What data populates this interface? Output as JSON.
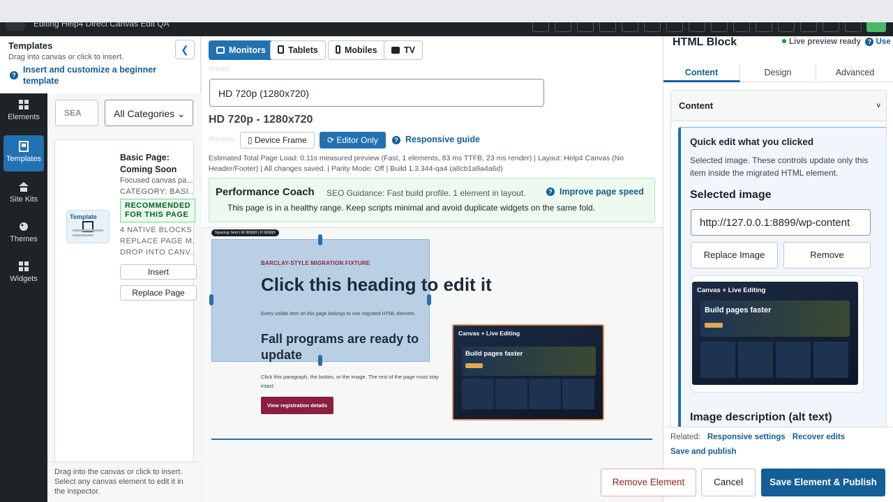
{
  "topbar": {
    "title": "Editing Help4 Direct Canvas Edit QA"
  },
  "rail": {
    "items": [
      {
        "label": "Elements",
        "icon": "grid-icon",
        "active": false
      },
      {
        "label": "Templates",
        "icon": "templates-icon",
        "active": true
      },
      {
        "label": "Site Kits",
        "icon": "site-kits-icon",
        "active": false
      },
      {
        "label": "Themes",
        "icon": "palette-icon",
        "active": false
      },
      {
        "label": "Widgets",
        "icon": "widgets-icon",
        "active": false
      }
    ]
  },
  "templates": {
    "title": "Templates",
    "subtitle": "Drag into canvas or click to insert.",
    "insert_link": "Insert and customize a beginner template",
    "search_placeholder": "SEA",
    "category": "All Categories",
    "card": {
      "name": "Basic Page: Coming Soon",
      "desc": "Focused canvas pa...",
      "category": "CATEGORY: BASI...",
      "badge": "RECOMMENDED FOR THIS PAGE",
      "thumb_label": "Template",
      "meta1": "4 NATIVE BLOCKS",
      "meta2": "REPLACE PAGE M...",
      "meta3": "DROP INTO CANV...",
      "insert": "Insert",
      "replace": "Replace Page"
    },
    "footer": "Drag into the canvas or click to insert. Select any canvas element to edit it in the inspector."
  },
  "center": {
    "devices": [
      "Monitors",
      "Tablets",
      "Mobiles",
      "TV"
    ],
    "preset_label": "Preset",
    "preset_value": "HD 720p (1280x720)",
    "resolution": "HD 720p - 1280x720",
    "preview_label": "Preview",
    "device_frame": "Device Frame",
    "editor_only": "Editor Only",
    "responsive_guide": "Responsive guide",
    "status_line": "Estimated Total Page Load: 0.11s measured preview (Fast, 1 elements, 83 ms TTFB, 23 ms render) | Layout: Help4 Canvas (No Header/Footer) | All changes saved. | Parity Mode: Off | Build 1.3.344-qa4 (a8cb1a9a4a6d)",
    "perf": {
      "title": "Performance Coach",
      "seo": "SEO Guidance: Fast build profile. 1 element in layout.",
      "improve": "Improve page speed",
      "message": "This page is in a healthy range. Keep scripts minimal and avoid duplicate widgets on the same fold."
    },
    "canvas": {
      "spacing": "Spacing: html | M 0|0|0|0 | P 0|0|0|0",
      "fixture": "BARCLAY-STYLE MIGRATION FIXTURE",
      "heading": "Click this heading to edit it",
      "lead": "Every visible item on this page belongs to one migrated HTML element.",
      "subheading": "Fall programs are ready to update",
      "para": "Click this paragraph, the button, or the image. The rest of the page must stay intact.",
      "cta": "View registration details",
      "hero_title": "Canvas + Live Editing",
      "hero_build": "Build pages faster"
    }
  },
  "inspector": {
    "title": "HTML Block",
    "live": "Live preview ready",
    "user_link": "Use",
    "tabs": [
      "Content",
      "Design",
      "Advanced"
    ],
    "section": "Content",
    "quick_title": "Quick edit what you clicked",
    "quick_desc": "Selected image. These controls update only this item inside the migrated HTML element.",
    "selected_image_label": "Selected image",
    "image_url": "http://127.0.0.1:8899/wp-content",
    "replace": "Replace Image",
    "remove": "Remove",
    "alt_label": "Image description (alt text)",
    "related_label": "Related:",
    "related_links": [
      "Responsive settings",
      "Recover edits"
    ],
    "save_publish_link": "Save and publish"
  },
  "footer": {
    "remove_element": "Remove Element",
    "cancel": "Cancel",
    "save": "Save Element & Publish"
  }
}
